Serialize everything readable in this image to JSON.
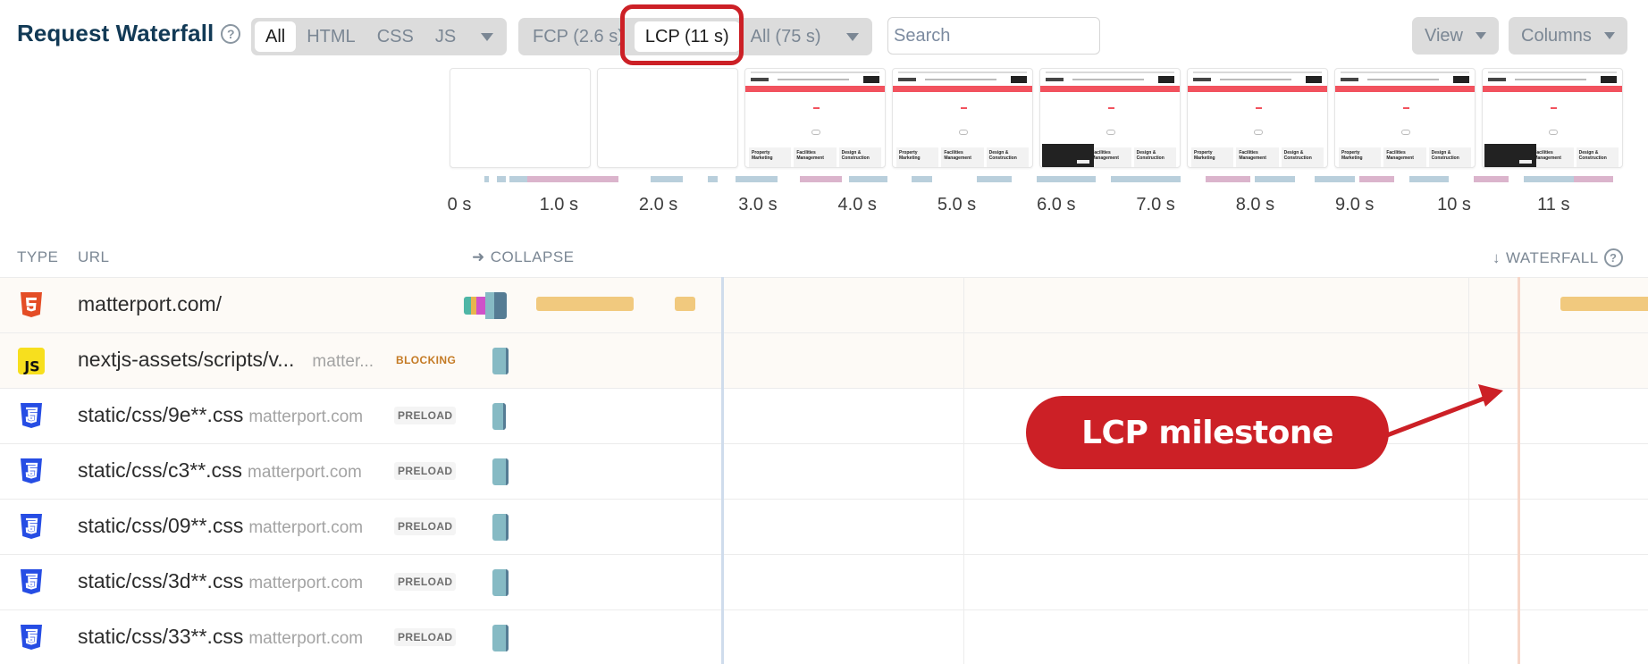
{
  "header": {
    "title": "Request Waterfall",
    "help_icon": "?",
    "type_filter": {
      "options": [
        "All",
        "HTML",
        "CSS",
        "JS"
      ],
      "selected": "All"
    },
    "milestone_filter": {
      "options": [
        "FCP (2.6 s)",
        "LCP (11 s)",
        "All (75 s)"
      ],
      "selected": "LCP (11 s)"
    },
    "search": {
      "placeholder": "Search",
      "value": ""
    },
    "view_label": "View",
    "columns_label": "Columns"
  },
  "filmstrip": {
    "frames": [
      {
        "state": "blank",
        "cookie": false
      },
      {
        "state": "blank",
        "cookie": false
      },
      {
        "state": "rendered",
        "cookie": false
      },
      {
        "state": "rendered",
        "cookie": false
      },
      {
        "state": "rendered",
        "cookie": true
      },
      {
        "state": "rendered",
        "cookie": false
      },
      {
        "state": "rendered",
        "cookie": false
      },
      {
        "state": "rendered",
        "cookie": true
      }
    ],
    "card_titles": [
      "Property Marketing",
      "Facilities Management",
      "Design & Construction"
    ],
    "axis_labels": [
      "0 s",
      "1.0 s",
      "2.0 s",
      "3.0 s",
      "4.0 s",
      "5.0 s",
      "6.0 s",
      "7.0 s",
      "8.0 s",
      "9.0 s",
      "10 s",
      "11 s"
    ],
    "axis_seconds": [
      0,
      1,
      2,
      3,
      4,
      5,
      6,
      7,
      8,
      9,
      10,
      11
    ],
    "axis_max_seconds": 11.6,
    "activity": [
      {
        "start": 0.25,
        "end": 0.3,
        "kind": "blue"
      },
      {
        "start": 0.38,
        "end": 0.47,
        "kind": "blue"
      },
      {
        "start": 0.5,
        "end": 0.68,
        "kind": "blue"
      },
      {
        "start": 0.68,
        "end": 1.6,
        "kind": "pink"
      },
      {
        "start": 1.92,
        "end": 2.25,
        "kind": "blue"
      },
      {
        "start": 2.5,
        "end": 2.6,
        "kind": "blue"
      },
      {
        "start": 2.78,
        "end": 3.2,
        "kind": "blue"
      },
      {
        "start": 3.42,
        "end": 3.85,
        "kind": "pink"
      },
      {
        "start": 3.92,
        "end": 4.3,
        "kind": "blue"
      },
      {
        "start": 4.55,
        "end": 4.75,
        "kind": "blue"
      },
      {
        "start": 5.2,
        "end": 5.55,
        "kind": "blue"
      },
      {
        "start": 5.8,
        "end": 6.4,
        "kind": "blue"
      },
      {
        "start": 6.55,
        "end": 7.25,
        "kind": "blue"
      },
      {
        "start": 7.5,
        "end": 7.95,
        "kind": "pink"
      },
      {
        "start": 8.0,
        "end": 8.4,
        "kind": "blue"
      },
      {
        "start": 8.6,
        "end": 9.0,
        "kind": "blue"
      },
      {
        "start": 9.05,
        "end": 9.4,
        "kind": "pink"
      },
      {
        "start": 9.55,
        "end": 9.95,
        "kind": "blue"
      },
      {
        "start": 10.2,
        "end": 10.55,
        "kind": "pink"
      },
      {
        "start": 10.7,
        "end": 11.2,
        "kind": "blue"
      },
      {
        "start": 11.2,
        "end": 11.6,
        "kind": "pink"
      }
    ]
  },
  "table": {
    "headers": {
      "type": "TYPE",
      "url": "URL",
      "collapse": "COLLAPSE",
      "waterfall": "WATERFALL"
    },
    "rows": [
      {
        "type": "html",
        "url": "matterport.com/",
        "domain": "",
        "badge": "",
        "highlight": true,
        "segments": [
          {
            "color": "#4fb6a6",
            "kind": "dns"
          },
          {
            "color": "#e8b54d",
            "kind": "connect"
          },
          {
            "color": "#cf52c9",
            "kind": "ssl"
          },
          {
            "color": "#86bac4",
            "kind": "wait"
          },
          {
            "color": "#557c94",
            "kind": "download"
          }
        ],
        "extra_bars": [
          {
            "start_s": 0.6,
            "end_s": 1.7,
            "color": "#f1c97e"
          },
          {
            "start_s": 2.1,
            "end_s": 2.35,
            "color": "#f1c97e"
          },
          {
            "start_s": 11.4,
            "end_s": 12.5,
            "color": "#f1c97e"
          }
        ]
      },
      {
        "type": "js",
        "url": "nextjs-assets/scripts/v...",
        "domain": "matter...",
        "badge": "BLOCKING",
        "highlight": true,
        "segments": [],
        "extra_bars": []
      },
      {
        "type": "css",
        "url": "static/css/9e**.css",
        "domain": "matterport.com",
        "badge": "PRELOAD",
        "highlight": false,
        "segments": [],
        "extra_bars": []
      },
      {
        "type": "css",
        "url": "static/css/c3**.css",
        "domain": "matterport.com",
        "badge": "PRELOAD",
        "highlight": false,
        "segments": [],
        "extra_bars": []
      },
      {
        "type": "css",
        "url": "static/css/09**.css",
        "domain": "matterport.com",
        "badge": "PRELOAD",
        "highlight": false,
        "segments": [],
        "extra_bars": []
      },
      {
        "type": "css",
        "url": "static/css/3d**.css",
        "domain": "matterport.com",
        "badge": "PRELOAD",
        "highlight": false,
        "segments": [],
        "extra_bars": []
      },
      {
        "type": "css",
        "url": "static/css/33**.css",
        "domain": "matterport.com",
        "badge": "PRELOAD",
        "highlight": false,
        "segments": [],
        "extra_bars": []
      }
    ],
    "milestones": {
      "fcp_seconds": 2.6,
      "lcp_seconds": 11
    }
  },
  "annotation": {
    "text": "LCP milestone",
    "color": "#cc2026"
  },
  "colors": {
    "html_icon": "#e44d26",
    "js_icon": "#f7df1e",
    "css_icon": "#264de4",
    "request_bar": "#86bac4",
    "request_bar_edge": "#557c94",
    "response_bar": "#f1c97e"
  }
}
